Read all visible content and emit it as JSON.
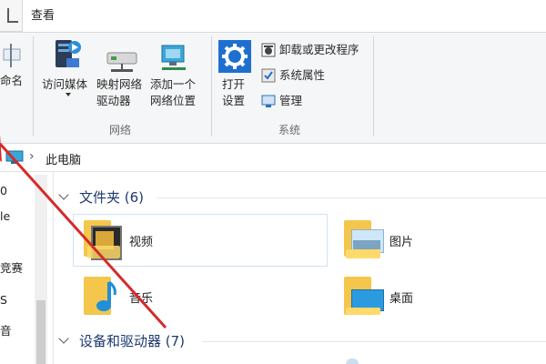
{
  "ribbon": {
    "tab_view": "查看",
    "left_partial": "命名",
    "access_media_label": "访问媒体",
    "map_drive_label_1": "映射网络",
    "map_drive_label_2": "驱动器",
    "add_location_label_1": "添加一个",
    "add_location_label_2": "网络位置",
    "group_network": "网络",
    "open_settings_label_1": "打开",
    "open_settings_label_2": "设置",
    "uninstall_label": "卸载或更改程序",
    "sys_props_label": "系统属性",
    "manage_label": "管理",
    "group_system": "系统"
  },
  "address": {
    "separator": "›",
    "location": "此电脑"
  },
  "nav": {
    "items": [
      "0",
      "le",
      "竞赛",
      "S",
      "音"
    ]
  },
  "content": {
    "folders_group": "文件夹 (6)",
    "devices_group": "设备和驱动器 (7)",
    "folders": [
      {
        "label": "视频"
      },
      {
        "label": "图片"
      },
      {
        "label": "音乐"
      },
      {
        "label": "桌面"
      }
    ]
  },
  "colors": {
    "annotation_arrow": "#d62a2a",
    "accent": "#1e3a6e"
  }
}
